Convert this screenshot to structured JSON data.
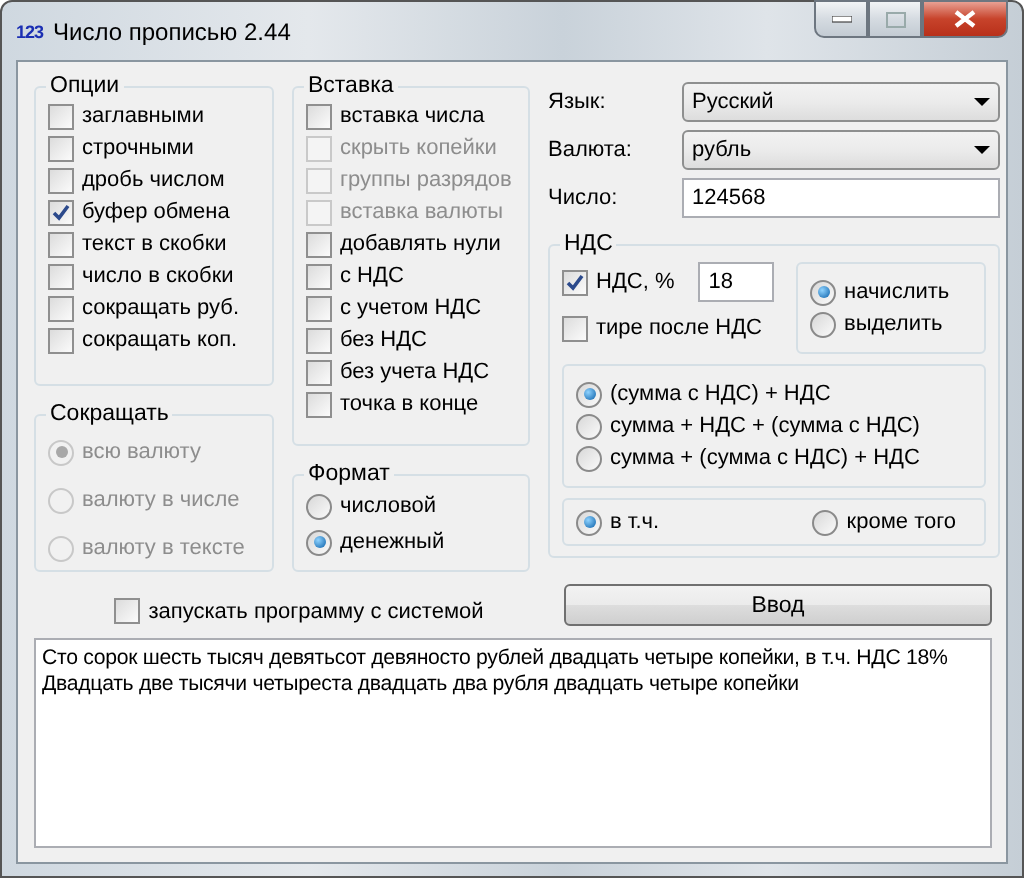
{
  "window": {
    "icon_text": "123",
    "title": "Число прописью 2.44"
  },
  "options": {
    "title": "Опции",
    "items": [
      {
        "label": "заглавными",
        "checked": false
      },
      {
        "label": "строчными",
        "checked": false
      },
      {
        "label": "дробь числом",
        "checked": false
      },
      {
        "label": "буфер обмена",
        "checked": true
      },
      {
        "label": "текст в скобки",
        "checked": false
      },
      {
        "label": "число в скобки",
        "checked": false
      },
      {
        "label": "сокращать руб.",
        "checked": false
      },
      {
        "label": "сокращать коп.",
        "checked": false
      }
    ]
  },
  "shorten": {
    "title": "Сокращать",
    "items": [
      {
        "label": "всю валюту",
        "selected": true,
        "disabled": true
      },
      {
        "label": "валюту в числе",
        "selected": false,
        "disabled": true
      },
      {
        "label": "валюту в тексте",
        "selected": false,
        "disabled": true
      }
    ]
  },
  "insert": {
    "title": "Вставка",
    "items": [
      {
        "label": "вставка числа",
        "checked": false,
        "disabled": false
      },
      {
        "label": "скрыть копейки",
        "checked": false,
        "disabled": true
      },
      {
        "label": "группы разрядов",
        "checked": false,
        "disabled": true
      },
      {
        "label": "вставка валюты",
        "checked": false,
        "disabled": true
      },
      {
        "label": "добавлять нули",
        "checked": false,
        "disabled": false
      },
      {
        "label": "с НДС",
        "checked": false,
        "disabled": false
      },
      {
        "label": "с учетом НДС",
        "checked": false,
        "disabled": false
      },
      {
        "label": "без НДС",
        "checked": false,
        "disabled": false
      },
      {
        "label": "без учета НДС",
        "checked": false,
        "disabled": false
      },
      {
        "label": "точка в конце",
        "checked": false,
        "disabled": false
      }
    ]
  },
  "format": {
    "title": "Формат",
    "items": [
      {
        "label": "числовой",
        "selected": false
      },
      {
        "label": "денежный",
        "selected": true
      }
    ]
  },
  "fields": [
    {
      "kind": "dropdown",
      "label": "Язык:",
      "value": "Русский"
    },
    {
      "kind": "dropdown",
      "label": "Валюта:",
      "value": "рубль"
    },
    {
      "kind": "input",
      "label": "Число:",
      "value": "124568"
    }
  ],
  "vat": {
    "title": "НДС",
    "rate_checkbox": {
      "label": "НДС, %",
      "checked": true
    },
    "rate": "18",
    "dash_checkbox": {
      "label": "тире после НДС",
      "checked": false
    },
    "mode": [
      {
        "label": "начислить",
        "selected": true
      },
      {
        "label": "выделить",
        "selected": false
      }
    ],
    "formula": [
      {
        "label": "(сумма с НДС) + НДС",
        "selected": true
      },
      {
        "label": "сумма + НДС + (сумма с НДС)",
        "selected": false
      },
      {
        "label": "сумма + (сумма с НДС) + НДС",
        "selected": false
      }
    ],
    "inclusion": [
      {
        "label": "в т.ч.",
        "selected": true
      },
      {
        "label": "кроме того",
        "selected": false
      }
    ]
  },
  "autostart": {
    "label": "запускать программу с системой",
    "checked": false
  },
  "enter_button": "Ввод",
  "output": "Сто сорок шесть тысяч девятьсот девяносто рублей двадцать четыре копейки, в т.ч. НДС 18% Двадцать две тысячи четыреста двадцать два рубля двадцать четыре копейки"
}
